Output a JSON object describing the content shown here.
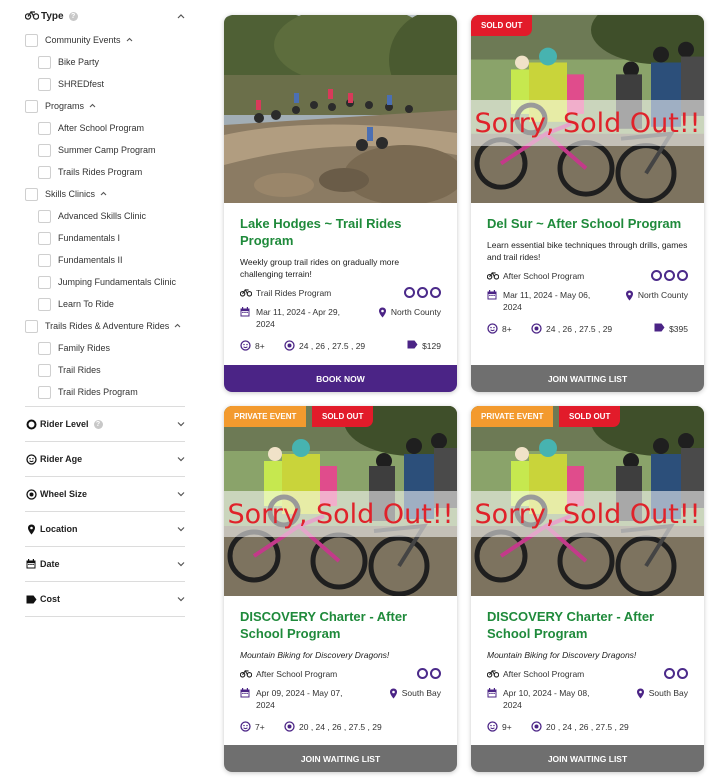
{
  "sidebar": {
    "type_label": "Type",
    "help_glyph": "?",
    "tree": [
      {
        "label": "Community Events",
        "level": 0,
        "expandable": true
      },
      {
        "label": "Bike Party",
        "level": 1
      },
      {
        "label": "SHREDfest",
        "level": 1
      },
      {
        "label": "Programs",
        "level": 0,
        "expandable": true
      },
      {
        "label": "After School Program",
        "level": 1
      },
      {
        "label": "Summer Camp Program",
        "level": 1
      },
      {
        "label": "Trails Rides Program",
        "level": 1
      },
      {
        "label": "Skills Clinics",
        "level": 0,
        "expandable": true
      },
      {
        "label": "Advanced Skills Clinic",
        "level": 1
      },
      {
        "label": "Fundamentals I",
        "level": 1
      },
      {
        "label": "Fundamentals II",
        "level": 1
      },
      {
        "label": "Jumping Fundamentals Clinic",
        "level": 1
      },
      {
        "label": "Learn To Ride",
        "level": 1
      },
      {
        "label": "Trails Rides & Adventure Rides",
        "level": 0,
        "expandable": true
      },
      {
        "label": "Family Rides",
        "level": 1
      },
      {
        "label": "Trail Rides",
        "level": 1
      },
      {
        "label": "Trail Rides Program",
        "level": 1
      }
    ],
    "facets": [
      {
        "label": "Rider Level",
        "icon": "ring-icon",
        "help": true
      },
      {
        "label": "Rider Age",
        "icon": "face-icon",
        "help": false
      },
      {
        "label": "Wheel Size",
        "icon": "wheel-icon",
        "help": false
      },
      {
        "label": "Location",
        "icon": "pin-icon",
        "help": false
      },
      {
        "label": "Date",
        "icon": "calendar-icon",
        "help": false
      },
      {
        "label": "Cost",
        "icon": "tag-icon",
        "help": false
      }
    ]
  },
  "colors": {
    "title_green": "#1f8a3b",
    "brand_purple": "#4b2486",
    "sold_red": "#e21b2a",
    "private_orange": "#f39a2e",
    "waitlist_gray": "#6f6f6f"
  },
  "cards": [
    {
      "badges": [],
      "sold_out_overlay": "",
      "title": "Lake Hodges ~ Trail Rides Program",
      "description": "Weekly group trail rides on gradually more challenging terrain!",
      "category": "Trail Rides Program",
      "level_rings": 3,
      "dates": "Mar 11, 2024 - Apr 29, 2024",
      "location": "North County",
      "age": "8+",
      "wheels": "24 , 26 , 27.5 , 29",
      "cost": "$129",
      "cta": "BOOK NOW",
      "cta_style": "book"
    },
    {
      "badges": [
        "SOLD OUT"
      ],
      "sold_out_overlay": "Sorry, Sold Out!!",
      "title": "Del Sur ~ After School Program",
      "description": "Learn essential bike techniques through drills, games and trail rides!",
      "category": "After School Program",
      "level_rings": 3,
      "dates": "Mar 11, 2024 - May 06, 2024",
      "location": "North County",
      "age": "8+",
      "wheels": "24 , 26 , 27.5 , 29",
      "cost": "$395",
      "cta": "JOIN WAITING LIST",
      "cta_style": "wait"
    },
    {
      "badges": [
        "PRIVATE EVENT",
        "SOLD OUT"
      ],
      "sold_out_overlay": "Sorry, Sold Out!!",
      "title": "DISCOVERY Charter - After School Program",
      "description": "Mountain Biking for Discovery Dragons!",
      "category": "After School Program",
      "level_rings": 2,
      "dates": "Apr 09, 2024 - May 07, 2024",
      "location": "South Bay",
      "age": "7+",
      "wheels": "20 , 24 , 26 , 27.5 , 29",
      "cost": "",
      "cta": "JOIN WAITING LIST",
      "cta_style": "wait"
    },
    {
      "badges": [
        "PRIVATE EVENT",
        "SOLD OUT"
      ],
      "sold_out_overlay": "Sorry, Sold Out!!",
      "title": "DISCOVERY Charter - After School Program",
      "description": "Mountain Biking for Discovery Dragons!",
      "category": "After School Program",
      "level_rings": 2,
      "dates": "Apr 10, 2024 - May 08, 2024",
      "location": "South Bay",
      "age": "9+",
      "wheels": "20 , 24 , 26 , 27.5 , 29",
      "cost": "",
      "cta": "JOIN WAITING LIST",
      "cta_style": "wait"
    }
  ]
}
